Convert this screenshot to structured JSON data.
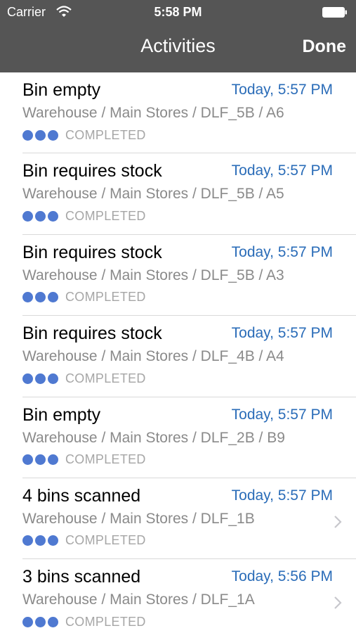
{
  "status_bar": {
    "carrier": "Carrier",
    "time": "5:58 PM"
  },
  "nav": {
    "title": "Activities",
    "done_label": "Done"
  },
  "colors": {
    "nav_bg": "#555555",
    "time_blue": "#2a6cb8",
    "dot_blue": "#4f79d1",
    "path_gray": "#8a8a8a",
    "status_gray": "#a6a6a6"
  },
  "activities": [
    {
      "title": "Bin empty",
      "time": "Today, 5:57 PM",
      "path": "Warehouse / Main Stores / DLF_5B / A6",
      "status": "COMPLETED",
      "has_chevron": false
    },
    {
      "title": "Bin requires stock",
      "time": "Today, 5:57 PM",
      "path": "Warehouse / Main Stores / DLF_5B / A5",
      "status": "COMPLETED",
      "has_chevron": false
    },
    {
      "title": "Bin requires stock",
      "time": "Today, 5:57 PM",
      "path": "Warehouse / Main Stores / DLF_5B / A3",
      "status": "COMPLETED",
      "has_chevron": false
    },
    {
      "title": "Bin requires stock",
      "time": "Today, 5:57 PM",
      "path": "Warehouse / Main Stores / DLF_4B / A4",
      "status": "COMPLETED",
      "has_chevron": false
    },
    {
      "title": "Bin empty",
      "time": "Today, 5:57 PM",
      "path": "Warehouse / Main Stores / DLF_2B / B9",
      "status": "COMPLETED",
      "has_chevron": false
    },
    {
      "title": "4 bins scanned",
      "time": "Today, 5:57 PM",
      "path": "Warehouse / Main Stores / DLF_1B",
      "status": "COMPLETED",
      "has_chevron": true
    },
    {
      "title": "3 bins scanned",
      "time": "Today, 5:56 PM",
      "path": "Warehouse / Main Stores / DLF_1A",
      "status": "COMPLETED",
      "has_chevron": true
    }
  ]
}
